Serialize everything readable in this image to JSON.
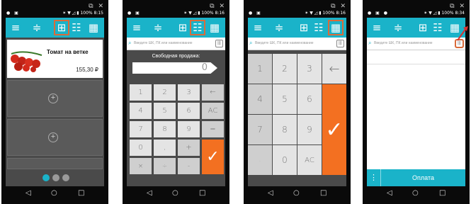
{
  "window_controls": "⧉ ✕",
  "status_bar": {
    "left": "● ▣",
    "left_dot": "● ▣ ●",
    "right_1": "✶ ▼ ◿ ▮ 100% 8:15",
    "right_2": "✶ ▼ ◿ ▮ 100% 8:16",
    "right_3": "✶ ▼ ◿ ▮ 100% 8:34"
  },
  "toolbar": {
    "menu": "≡",
    "filter": "≑",
    "grid_small": "⊞",
    "list": "☷",
    "grid_big": "▦"
  },
  "search": {
    "placeholder": "Введите ШК, ПК или наименование",
    "icon": "⌕",
    "barcode": "|||"
  },
  "product": {
    "name": "Томат на ветке",
    "price": "155,30 ₽"
  },
  "add_tile": "+",
  "free_sale": {
    "label": "Свободная продажа:",
    "value": "0"
  },
  "keypad_small": [
    "1",
    "2",
    "3",
    "←",
    "4",
    "5",
    "6",
    "AC",
    "7",
    "8",
    "9",
    "=",
    "0",
    ",",
    "+",
    "×",
    "÷",
    "-",
    "✓"
  ],
  "keypad_big": [
    "1",
    "2",
    "3",
    "←",
    "4",
    "5",
    "6",
    "7",
    "8",
    "9",
    ".",
    "0",
    "AC",
    "✓"
  ],
  "pay": {
    "label": "Оплата",
    "more": "⋮"
  },
  "nav": {
    "back": "◁",
    "home": "○",
    "recent": "□"
  }
}
